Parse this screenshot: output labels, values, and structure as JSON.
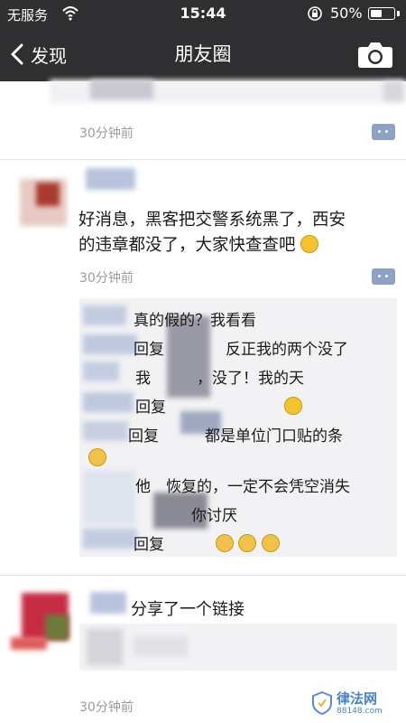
{
  "status_bar": {
    "carrier": "无服务",
    "time": "15:44",
    "battery": "50%",
    "battery_level": 0.5
  },
  "nav": {
    "back_label": "发现",
    "title": "朋友圈"
  },
  "post1": {
    "time": "30分钟前"
  },
  "post2": {
    "text_line1": "好消息，黑客把交警系统黑了，西安",
    "text_line2": "的违章都没了，大家快查查吧",
    "time": "30分钟前",
    "comments": [
      "真的假的？我看看",
      "回复　　　　反正我的两个没了",
      "我　　　，没了！我的天",
      "回复",
      "回复　　　都是单位门口贴的条",
      "他　恢复的，一定不会凭空消失",
      "　　　　你讨厌",
      "回复"
    ]
  },
  "post3": {
    "share_text": "分享了一个链接",
    "time": "30分钟前"
  },
  "watermark": {
    "text": "律法网",
    "url": "88148.com"
  }
}
